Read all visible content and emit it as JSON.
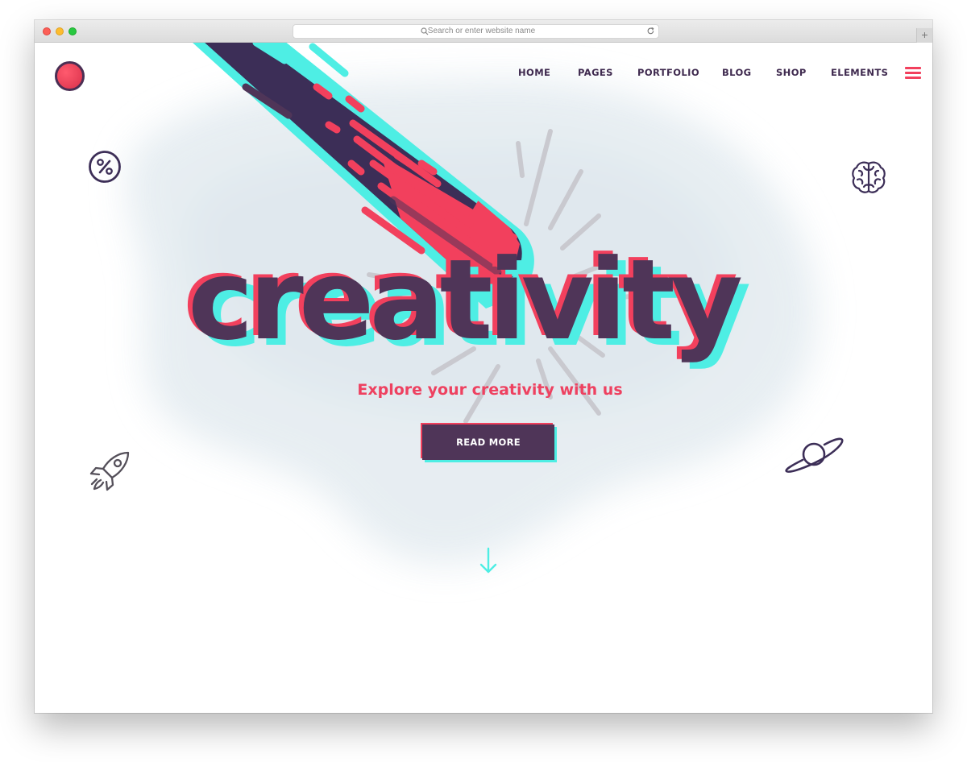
{
  "browser": {
    "address_placeholder": "Search or enter website name",
    "newtab_label": "+"
  },
  "nav": {
    "items": [
      {
        "label": "HOME",
        "active": true
      },
      {
        "label": "PAGES",
        "active": false
      },
      {
        "label": "PORTFOLIO",
        "active": false
      },
      {
        "label": "BLOG",
        "active": false
      },
      {
        "label": "SHOP",
        "active": false
      },
      {
        "label": "ELEMENTS",
        "active": false
      }
    ]
  },
  "hero": {
    "headline": "creativity",
    "subtitle": "Explore your creativity with us",
    "cta_label": "READ MORE"
  },
  "icons": {
    "logo": "logo-dot",
    "percent": "percent-icon",
    "brain": "brain-icon",
    "rocket": "rocket-icon",
    "planet": "planet-icon",
    "menu": "hamburger-icon",
    "scroll": "arrow-down-icon"
  },
  "colors": {
    "primary": "#4f3558",
    "accent_red": "#f2405d",
    "accent_cyan": "#4eeee4",
    "text_dark": "#3f2a4f"
  }
}
